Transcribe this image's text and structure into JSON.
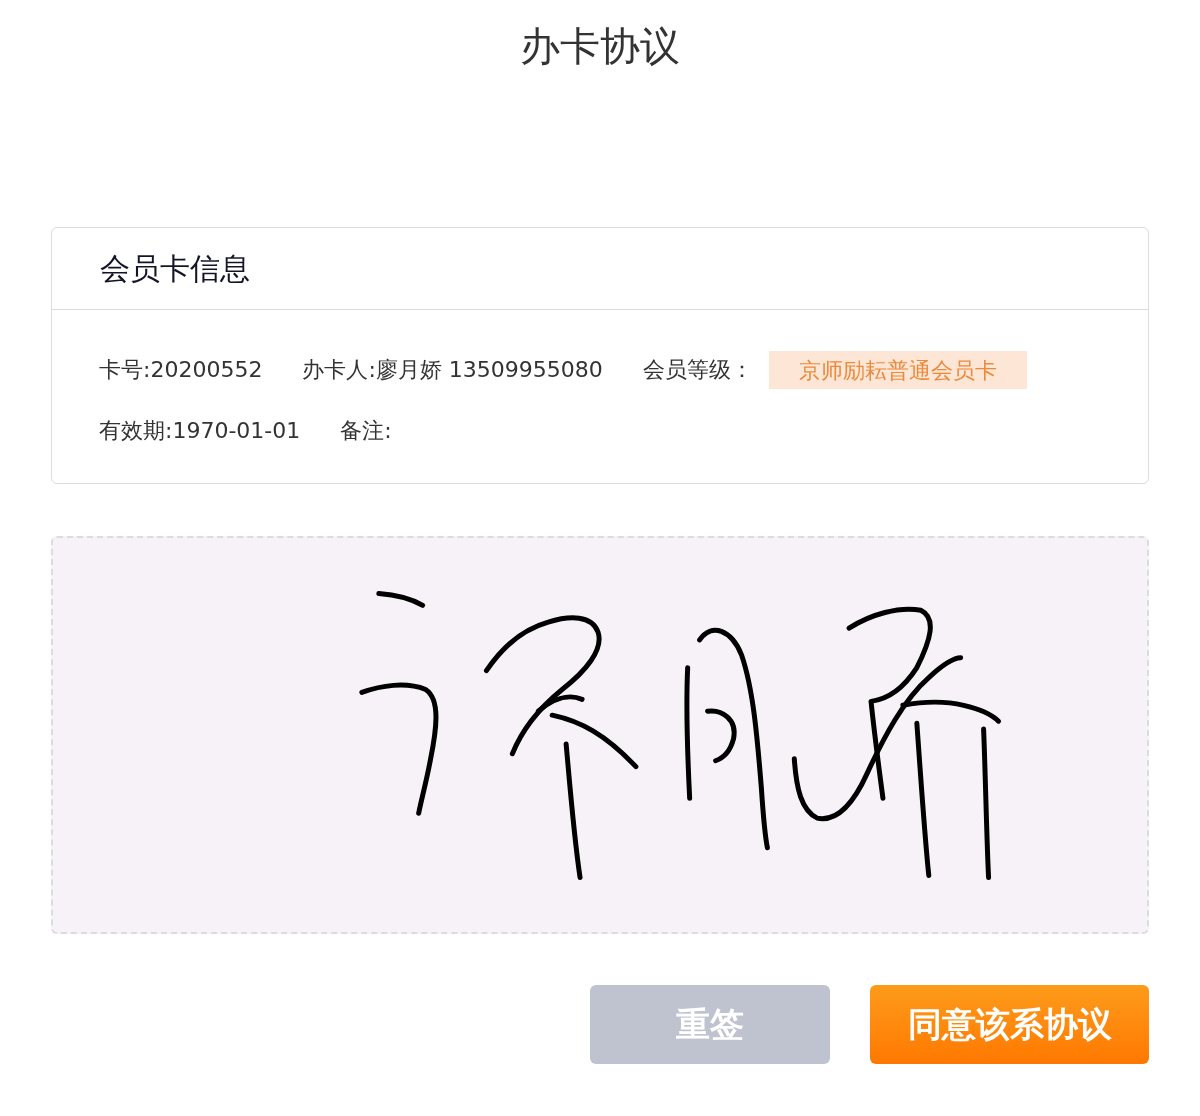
{
  "page": {
    "title": "办卡协议"
  },
  "member_card": {
    "heading": "会员卡信息",
    "rows": [
      {
        "items": [
          {
            "kind": "text",
            "text": "卡号:20200552"
          },
          {
            "kind": "text",
            "text": "办卡人:廖月娇 13509955080"
          },
          {
            "kind": "label",
            "text": "会员等级："
          },
          {
            "kind": "tag",
            "text": "京师励耘普通会员卡"
          }
        ]
      },
      {
        "items": [
          {
            "kind": "text",
            "text": "有效期:1970-01-01"
          },
          {
            "kind": "text",
            "text": "备注:"
          }
        ]
      }
    ]
  },
  "signature_pad": {
    "signed": true
  },
  "buttons": [
    {
      "kind": "secondary",
      "label": "重签"
    },
    {
      "kind": "primary",
      "label": "同意该系协议"
    }
  ]
}
